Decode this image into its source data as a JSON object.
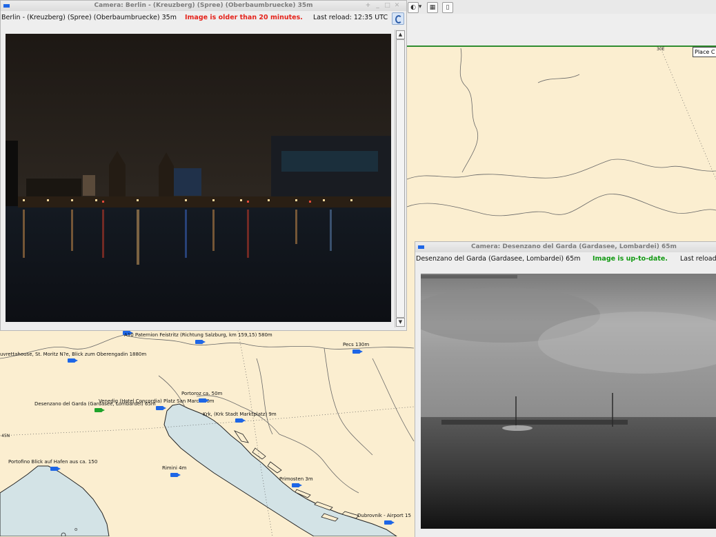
{
  "map": {
    "graticule": {
      "lon_label": "30E",
      "lat_label": "45N"
    },
    "place_box": "Place C",
    "cameras": [
      {
        "label": "A10 Paternion Feistritz (Richtung Salzburg, km 159,15) 580m",
        "status": "blue"
      },
      {
        "label": "uvrettahouse, St. Moritz N?e, Blick zum Oberengadin 1880m",
        "status": "blue"
      },
      {
        "label": "Pecs 130m",
        "status": "blue"
      },
      {
        "label": "Desenzano del Garda (Gardasee, Lombardei) 65m",
        "status": "green"
      },
      {
        "label": "Venedig (Hotel Concordia) Platz San Marco 10m",
        "status": "blue"
      },
      {
        "label": "Portoroz ca. 50m",
        "status": "blue"
      },
      {
        "label": "Krk, (Krk Stadt Marktplatz) 9m",
        "status": "blue"
      },
      {
        "label": "Portofino Blick auf Hafen aus ca. 150",
        "status": "blue"
      },
      {
        "label": "Rimini 4m",
        "status": "blue"
      },
      {
        "label": "Primosten 3m",
        "status": "blue"
      },
      {
        "label": "Dubrovnik - Airport 15",
        "status": "blue"
      }
    ],
    "colors": {
      "land": "#fbeed0",
      "sea": "#d3e3e6"
    }
  },
  "toolbar": {
    "icons": [
      "globe-icon",
      "layers-icon",
      "info-icon"
    ]
  },
  "camera_windows": [
    {
      "title": "Camera: Berlin - (Kreuzberg) (Spree) (Oberbaumbruecke) 35m",
      "location": "Berlin - (Kreuzberg) (Spree) (Oberbaumbruecke) 35m",
      "status": "Image is older than 20 minutes.",
      "status_color": "#e5231b",
      "reload": "Last reload: 12:35 UTC"
    },
    {
      "title": "Camera: Desenzano del Garda (Gardasee, Lombardei)  65m",
      "location": "Desenzano del Garda (Gardasee, Lombardei)  65m",
      "status": "Image is up-to-date.",
      "status_color": "#139a13",
      "reload": "Last reload"
    }
  ]
}
